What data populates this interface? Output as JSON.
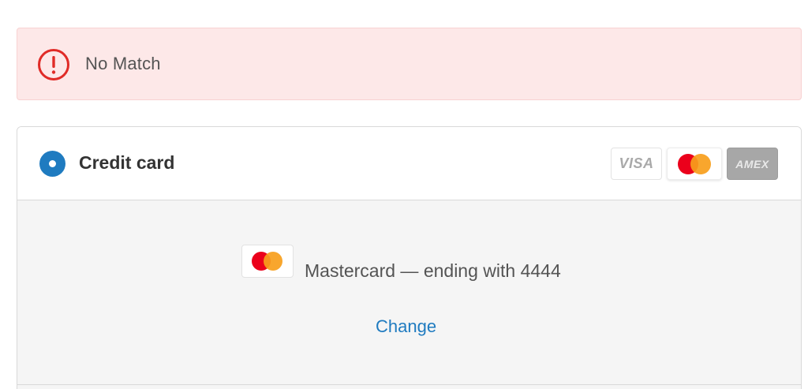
{
  "alert": {
    "message": "No Match",
    "icon": "exclamation-circle-icon",
    "color": "#e02b27"
  },
  "payment": {
    "method_label": "Credit card",
    "selected": true,
    "accent_color": "#1f7bc0",
    "brands": [
      {
        "name": "VISA",
        "icon": "visa-icon"
      },
      {
        "name": "Mastercard",
        "icon": "mastercard-icon"
      },
      {
        "name": "AMEX",
        "icon": "amex-icon"
      }
    ],
    "saved_card": {
      "description": "Mastercard — ending with 4444",
      "icon": "mastercard-icon"
    },
    "change_label": "Change"
  }
}
